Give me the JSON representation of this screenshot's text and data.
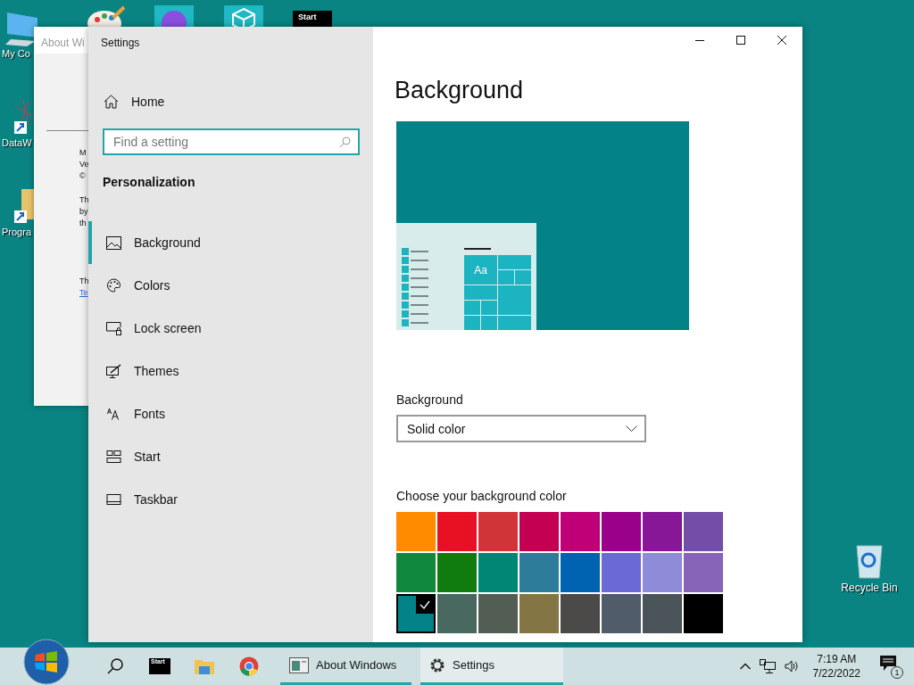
{
  "desktop_icons": [
    {
      "label": "My Co",
      "kind": "computer"
    },
    {
      "label": "DataW",
      "kind": "shortcut-app"
    },
    {
      "label": "Progra",
      "kind": "shortcut-folder"
    },
    {
      "label": "Recycle Bin",
      "kind": "recycle"
    }
  ],
  "top_tiles": [
    {
      "kind": "palette"
    },
    {
      "kind": "sphere"
    },
    {
      "kind": "cube"
    },
    {
      "kind": "start",
      "label": "Start"
    }
  ],
  "about_window": {
    "title": "About Wi",
    "blocks": [
      {
        "lines": [
          "M",
          "Ve",
          "©"
        ]
      },
      {
        "lines": [
          "Th",
          "by",
          "th"
        ]
      },
      {
        "lines": [
          "Th"
        ],
        "link": "Te"
      }
    ]
  },
  "settings": {
    "title": "Settings",
    "home": "Home",
    "search": {
      "placeholder": "Find a setting"
    },
    "section": "Personalization",
    "nav": [
      {
        "label": "Background",
        "kind": "image",
        "selected": true
      },
      {
        "label": "Colors",
        "kind": "palette",
        "selected": false
      },
      {
        "label": "Lock screen",
        "kind": "lock",
        "selected": false
      },
      {
        "label": "Themes",
        "kind": "themes",
        "selected": false
      },
      {
        "label": "Fonts",
        "kind": "fonts",
        "selected": false
      },
      {
        "label": "Start",
        "kind": "start",
        "selected": false
      },
      {
        "label": "Taskbar",
        "kind": "taskbar",
        "selected": false
      }
    ],
    "page_title": "Background",
    "preview_tile_text": "Aa",
    "background_label": "Background",
    "background_value": "Solid color",
    "color_label": "Choose your background color",
    "swatches": [
      {
        "color": "#ff8c00",
        "selected": false
      },
      {
        "color": "#e81123",
        "selected": false
      },
      {
        "color": "#d13438",
        "selected": false
      },
      {
        "color": "#c30052",
        "selected": false
      },
      {
        "color": "#bf0077",
        "selected": false
      },
      {
        "color": "#9a0089",
        "selected": false
      },
      {
        "color": "#881798",
        "selected": false
      },
      {
        "color": "#744da9",
        "selected": false
      },
      {
        "color": "#10893e",
        "selected": false
      },
      {
        "color": "#107c10",
        "selected": false
      },
      {
        "color": "#018574",
        "selected": false
      },
      {
        "color": "#2d7d9a",
        "selected": false
      },
      {
        "color": "#0063b1",
        "selected": false
      },
      {
        "color": "#6b69d6",
        "selected": false
      },
      {
        "color": "#8e8cd8",
        "selected": false
      },
      {
        "color": "#8764b8",
        "selected": false
      },
      {
        "color": "#038387",
        "selected": true
      },
      {
        "color": "#486860",
        "selected": false
      },
      {
        "color": "#525e54",
        "selected": false
      },
      {
        "color": "#847545",
        "selected": false
      },
      {
        "color": "#4c4a48",
        "selected": false
      },
      {
        "color": "#515c6b",
        "selected": false
      },
      {
        "color": "#4a5459",
        "selected": false
      },
      {
        "color": "#000000",
        "selected": false
      }
    ]
  },
  "taskbar": {
    "start_thumb_label": "Start",
    "tasks": [
      {
        "label": "About Windows",
        "kind": "window",
        "selected": false
      },
      {
        "label": "Settings",
        "kind": "gear",
        "selected": true
      }
    ],
    "time": "7:19 AM",
    "date": "7/22/2022",
    "notifications": "1"
  }
}
